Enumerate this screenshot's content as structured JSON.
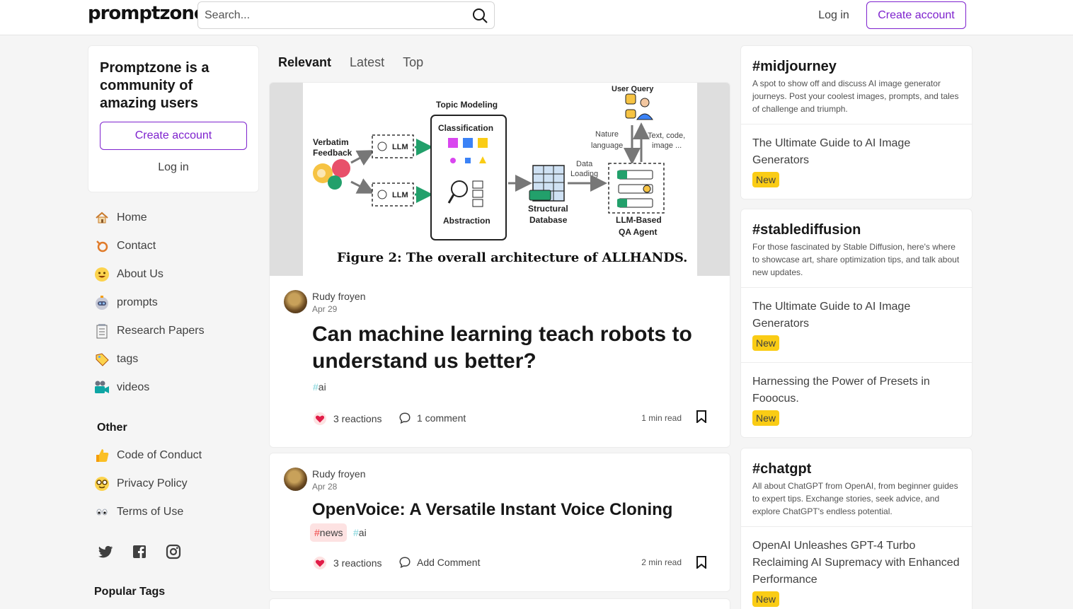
{
  "header": {
    "logo": "promptzone.",
    "search_placeholder": "Search...",
    "login_label": "Log in",
    "create_account_label": "Create account"
  },
  "intro": {
    "title": "Promptzone is a community of amazing users",
    "create_account_label": "Create account",
    "login_label": "Log in"
  },
  "nav": {
    "items": [
      {
        "label": "Home",
        "icon": "house-icon"
      },
      {
        "label": "Contact",
        "icon": "contact-icon"
      },
      {
        "label": "About Us",
        "icon": "smiley-icon"
      },
      {
        "label": "prompts",
        "icon": "robot-icon"
      },
      {
        "label": "Research Papers",
        "icon": "notepad-icon"
      },
      {
        "label": "tags",
        "icon": "label-tag-icon"
      },
      {
        "label": "videos",
        "icon": "video-camera-icon"
      }
    ],
    "other_title": "Other",
    "other_items": [
      {
        "label": "Code of Conduct",
        "icon": "thumbs-up-icon"
      },
      {
        "label": "Privacy Policy",
        "icon": "nerd-face-icon"
      },
      {
        "label": "Terms of Use",
        "icon": "eyes-icon"
      }
    ],
    "social": [
      "twitter-icon",
      "facebook-icon",
      "instagram-icon"
    ],
    "popular_tags_title": "Popular Tags"
  },
  "feed": {
    "tabs": [
      "Relevant",
      "Latest",
      "Top"
    ],
    "active_tab": "Relevant",
    "posts": [
      {
        "author": "Rudy froyen",
        "date": "Apr 29",
        "title": "Can machine learning teach robots to understand us better?",
        "tags": [
          "ai"
        ],
        "reactions": "3 reactions",
        "comments": "1 comment",
        "read_time": "1 min read",
        "cover": {
          "caption": "Figure 2: The overall architecture of ALLHANDS.",
          "labels": {
            "verbatim": "Verbatim",
            "feedback": "Feedback",
            "llm": "LLM",
            "topic_modeling": "Topic Modeling",
            "classification": "Classification",
            "abstraction": "Abstraction",
            "structural": "Structural",
            "database": "Database",
            "data": "Data",
            "loading": "Loading",
            "user_query": "User Query",
            "nature": "Nature",
            "language": "language",
            "text_code": "Text, code,",
            "image": "image ...",
            "llm_based": "LLM-Based",
            "qa_agent": "QA Agent"
          }
        }
      },
      {
        "author": "Rudy froyen",
        "date": "Apr 28",
        "title": "OpenVoice: A Versatile Instant Voice Cloning",
        "tags": [
          "news",
          "ai"
        ],
        "reactions": "3 reactions",
        "comments": "Add Comment",
        "read_time": "2 min read"
      }
    ]
  },
  "sidebar_right": {
    "cards": [
      {
        "title": "#midjourney",
        "description": "A spot to show off and discuss AI image generator journeys. Post your coolest images, prompts, and tales of challenge and triumph.",
        "items": [
          {
            "title": "The Ultimate Guide to AI Image Generators",
            "badge": "New"
          }
        ]
      },
      {
        "title": "#stablediffusion",
        "description": "For those fascinated by Stable Diffusion, here's where to showcase art, share optimization tips, and talk about new updates.",
        "items": [
          {
            "title": "The Ultimate Guide to AI Image Generators",
            "badge": "New"
          },
          {
            "title": "Harnessing the Power of Presets in Fooocus.",
            "badge": "New"
          }
        ]
      },
      {
        "title": "#chatgpt",
        "description": "All about ChatGPT from OpenAI, from beginner guides to expert tips. Exchange stories, seek advice, and explore ChatGPT's endless potential.",
        "items": [
          {
            "title": "OpenAI Unleashes GPT-4 Turbo Reclaiming AI Supremacy with Enhanced Performance",
            "badge": "New"
          }
        ]
      }
    ]
  }
}
